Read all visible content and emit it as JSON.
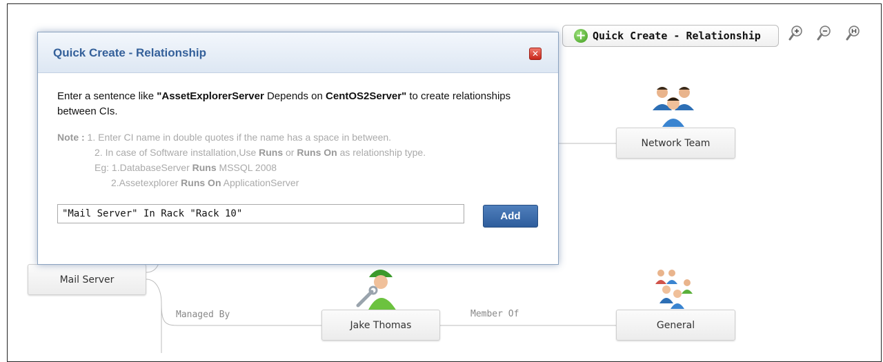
{
  "toolbar": {
    "quick_create_label": "Quick Create - Relationship",
    "zoom_in_icon": "zoom-in-icon",
    "zoom_out_icon": "zoom-out-icon",
    "zoom_reset_icon": "zoom-reset-icon"
  },
  "dialog": {
    "title": "Quick Create - Relationship",
    "close_icon": "close-icon",
    "intro_prefix": "Enter a sentence like ",
    "intro_example_ci1": "\"AssetExplorerServer",
    "intro_example_rel": " Depends on ",
    "intro_example_ci2": "CentOS2Server\"",
    "intro_suffix": " to create relationships between CIs.",
    "note_label": "Note :",
    "note_1": " 1. Enter CI name in double quotes if the name has a space in between.",
    "note_2_prefix": "2. In case of Software installation,Use ",
    "note_2_runs": "Runs",
    "note_2_or": " or ",
    "note_2_runs_on": "Runs On",
    "note_2_suffix": " as relationship type.",
    "eg_1_prefix": "Eg: 1.DatabaseServer ",
    "eg_1_runs": "Runs",
    "eg_1_suffix": " MSSQL 2008",
    "eg_2_prefix": "2.Assetexplorer ",
    "eg_2_runs_on": "Runs On",
    "eg_2_suffix": " ApplicationServer",
    "input_value": "\"Mail Server\" In Rack \"Rack 10\"",
    "add_label": "Add"
  },
  "graph": {
    "nodes": {
      "mail_server": "Mail Server",
      "network_team": "Network Team",
      "jake_thomas": "Jake Thomas",
      "general": "General"
    },
    "edges": {
      "managed_by": "Managed By",
      "member_of": "Member Of"
    },
    "icons": {
      "network_team": "group-icon",
      "jake_thomas": "technician-icon",
      "general": "group-icon"
    }
  },
  "colors": {
    "title_blue": "#34609a",
    "add_button": "#3a6aa8",
    "close_red": "#d0392b",
    "plus_green": "#4caf2a"
  }
}
